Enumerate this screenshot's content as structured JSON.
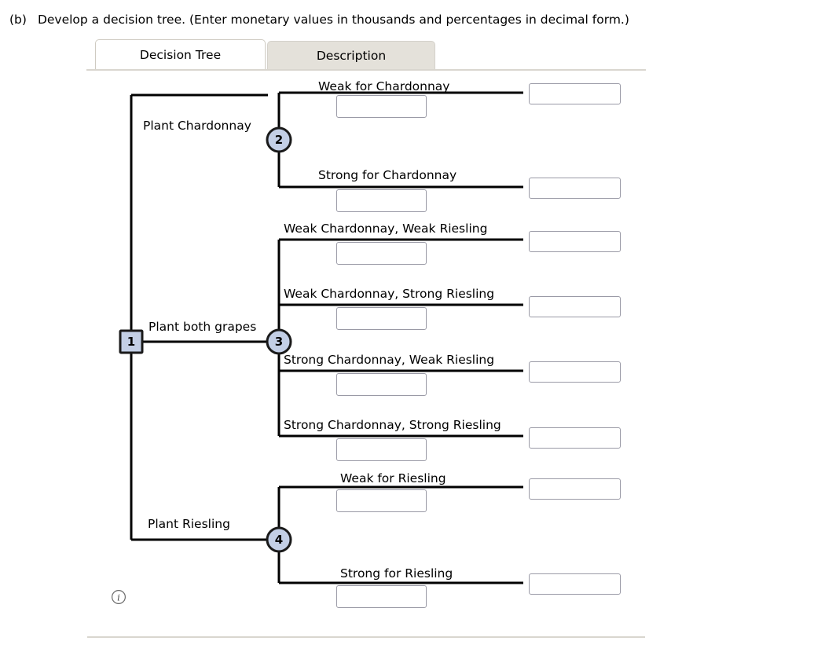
{
  "question": {
    "label": "(b)",
    "text": "Develop a decision tree. (Enter monetary values in thousands and percentages in decimal form.)"
  },
  "tabs": [
    {
      "id": "decision-tree",
      "label": "Decision Tree",
      "active": true
    },
    {
      "id": "description",
      "label": "Description",
      "active": false
    }
  ],
  "tree": {
    "nodes": [
      {
        "id": "1",
        "label": "1",
        "shape": "square",
        "type": "decision"
      },
      {
        "id": "2",
        "label": "2",
        "shape": "circle",
        "type": "chance"
      },
      {
        "id": "3",
        "label": "3",
        "shape": "circle",
        "type": "chance"
      },
      {
        "id": "4",
        "label": "4",
        "shape": "circle",
        "type": "chance"
      }
    ],
    "decision_branches": [
      {
        "id": "plant-chardonnay",
        "label": "Plant Chardonnay",
        "to_node": "2"
      },
      {
        "id": "plant-both-grapes",
        "label": "Plant both grapes",
        "to_node": "3"
      },
      {
        "id": "plant-riesling",
        "label": "Plant Riesling",
        "to_node": "4"
      }
    ],
    "outcome_branches": [
      {
        "id": "weak-chardonnay",
        "label": "Weak for Chardonnay",
        "from_node": "2",
        "probability": "",
        "payoff": ""
      },
      {
        "id": "strong-chardonnay",
        "label": "Strong for Chardonnay",
        "from_node": "2",
        "probability": "",
        "payoff": ""
      },
      {
        "id": "weak-chard-weak-ries",
        "label": "Weak Chardonnay, Weak Riesling",
        "from_node": "3",
        "probability": "",
        "payoff": ""
      },
      {
        "id": "weak-chard-strong-ries",
        "label": "Weak Chardonnay, Strong Riesling",
        "from_node": "3",
        "probability": "",
        "payoff": ""
      },
      {
        "id": "strong-chard-weak-ries",
        "label": "Strong Chardonnay, Weak Riesling",
        "from_node": "3",
        "probability": "",
        "payoff": ""
      },
      {
        "id": "strong-chard-strong-ries",
        "label": "Strong Chardonnay, Strong Riesling",
        "from_node": "3",
        "probability": "",
        "payoff": ""
      },
      {
        "id": "weak-riesling",
        "label": "Weak for Riesling",
        "from_node": "4",
        "probability": "",
        "payoff": ""
      },
      {
        "id": "strong-riesling",
        "label": "Strong for Riesling",
        "from_node": "4",
        "probability": "",
        "payoff": ""
      }
    ],
    "input_placeholder": ""
  },
  "icons": {
    "info": "info-icon"
  },
  "colors": {
    "node_fill": "#c3cfe6",
    "node_stroke": "#1a1a1a",
    "branch_line": "#000000",
    "tab_active_bg": "#ffffff",
    "tab_inactive_bg": "#e4e1da",
    "divider": "#d9d6cf",
    "input_border": "#9a9aa6"
  }
}
